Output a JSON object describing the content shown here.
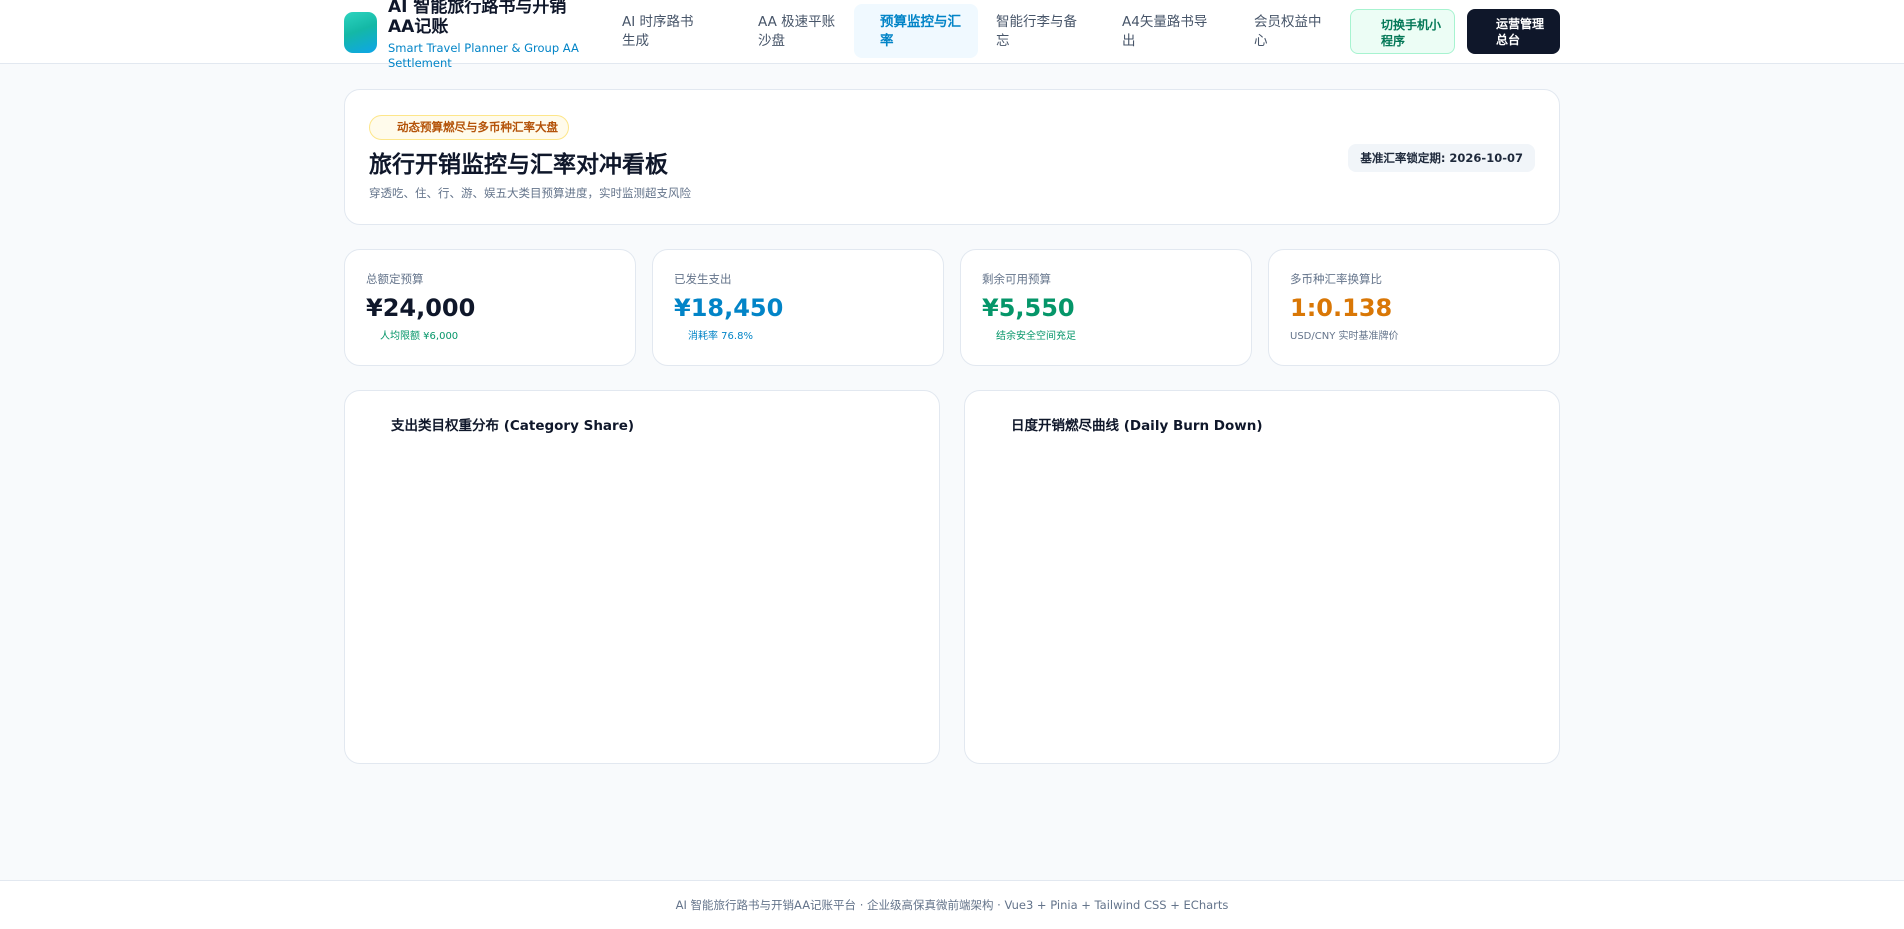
{
  "colors": {
    "accent": "#0284c7",
    "spent": "#0ea5e9",
    "remaining": "#059669",
    "fx": "#d97706",
    "dark": "#0f172a"
  },
  "header": {
    "brand_title": "AI 智能旅行路书与开销AA记账",
    "brand_subtitle": "Smart Travel Planner & Group AA Settlement",
    "nav": [
      {
        "label": "AI 时序路书生成",
        "active": false
      },
      {
        "label": "AA 极速平账沙盘",
        "active": false
      },
      {
        "label": "预算监控与汇率",
        "active": true
      },
      {
        "label": "智能行李与备忘",
        "active": false
      },
      {
        "label": "A4矢量路书导出",
        "active": false
      },
      {
        "label": "会员权益中心",
        "active": false
      }
    ],
    "mini_program_label": "切换手机小程序",
    "admin_label": "运营管理总台"
  },
  "hero": {
    "badge": "动态预算燃尽与多币种汇率大盘",
    "title": "旅行开销监控与汇率对冲看板",
    "description": "穿透吃、住、行、游、娱五大类目预算进度，实时监测超支风险",
    "rate_lock": "基准汇率锁定期: 2026-10-07"
  },
  "stats": [
    {
      "label": "总额定预算",
      "value": "¥24,000",
      "note": "人均限额 ¥6,000"
    },
    {
      "label": "已发生支出",
      "value": "¥18,450",
      "note": "消耗率 76.8%"
    },
    {
      "label": "剩余可用预算",
      "value": "¥5,550",
      "note": "结余安全空间充足"
    },
    {
      "label": "多币种汇率换算比",
      "value": "1:0.138",
      "note": "USD/CNY 实时基准牌价"
    }
  ],
  "panels": {
    "category_title": "支出类目权重分布 (Category Share)",
    "burn_title": "日度开销燃尽曲线 (Daily Burn Down)"
  },
  "footer": {
    "text": "AI 智能旅行路书与开销AA记账平台 · 企业级高保真微前端架构 · Vue3 + Pinia + Tailwind CSS + ECharts"
  }
}
